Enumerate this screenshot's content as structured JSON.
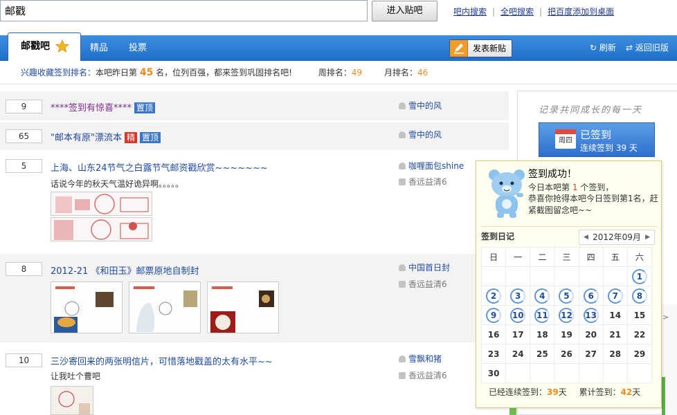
{
  "search": {
    "query": "邮戳",
    "button": "进入贴吧"
  },
  "toplinks": [
    "吧内搜索",
    "全吧搜索",
    "把百度添加到桌面"
  ],
  "nav": {
    "forum_tab": "邮戳吧",
    "tabs": [
      "精品",
      "投票"
    ],
    "post_button": "发表新贴",
    "refresh": "刷新",
    "old_version": "返回旧版"
  },
  "rank": {
    "label": "兴趣收藏签到排名：",
    "text1": "本吧昨日第",
    "num": "45",
    "text2": "名，位列百强，都来签到巩固排名吧!",
    "week_label": "周排名：",
    "week": "49",
    "month_label": "月排名：",
    "month": "46"
  },
  "threads": [
    {
      "count": "9",
      "title": "****签到有惊喜****",
      "badges": [
        "置顶"
      ],
      "author": "雪中的风"
    },
    {
      "count": "65",
      "title": "\"邮本有原\"漂流本",
      "badges": [
        "精",
        "置顶"
      ],
      "author": "雪中的风"
    },
    {
      "count": "5",
      "title": "上海、山东24节气之白露节气邮资戳欣赏~~~~~~~",
      "desc": "话说今年的秋天气温好诡异啊。。。。。",
      "author": "咖喱面包shine",
      "last_reply": "香远益清6"
    },
    {
      "count": "8",
      "title": "2012-21 《和田玉》邮票原地自制封",
      "author": "中国首日封",
      "last_reply": "香远益清6"
    },
    {
      "count": "10",
      "title": "三沙寄回来的两张明信片，可惜落地戳盖的太有水平~~",
      "desc": "让我吐个曹吧",
      "author": "雪飘和猪",
      "last_reply": "香远益清6"
    }
  ],
  "signin": {
    "slogan": "记录共同成长的每一天",
    "weekday": "周四",
    "status": "已签到",
    "streak_text": "连续签到 39 天",
    "popup_title": "签到成功！",
    "popup_rank_pre": "今日本吧第",
    "popup_rank": "1",
    "popup_rank_post": "个签到，",
    "popup_msg": "恭喜你抢得本吧今日签到第1名，赶紧截图留念吧~~",
    "diary_label": "签到日记",
    "month": "2012年09月",
    "weekdays": [
      "日",
      "一",
      "二",
      "三",
      "四",
      "五",
      "六"
    ],
    "days": [
      1,
      2,
      3,
      4,
      5,
      6,
      7,
      8,
      9,
      10,
      11,
      12,
      13,
      14,
      15,
      16,
      17,
      18,
      19,
      20,
      21,
      22,
      23,
      24,
      25,
      26,
      27,
      28,
      29,
      30
    ],
    "signed_days": [
      1,
      2,
      3,
      4,
      5,
      6,
      7,
      8,
      9,
      10,
      11,
      12,
      13
    ],
    "first_weekday": 6,
    "streak_label": "已经连续签到：",
    "streak_days": "39",
    "total_label": "累计签到：",
    "total_days": "42",
    "day_unit": "天"
  }
}
